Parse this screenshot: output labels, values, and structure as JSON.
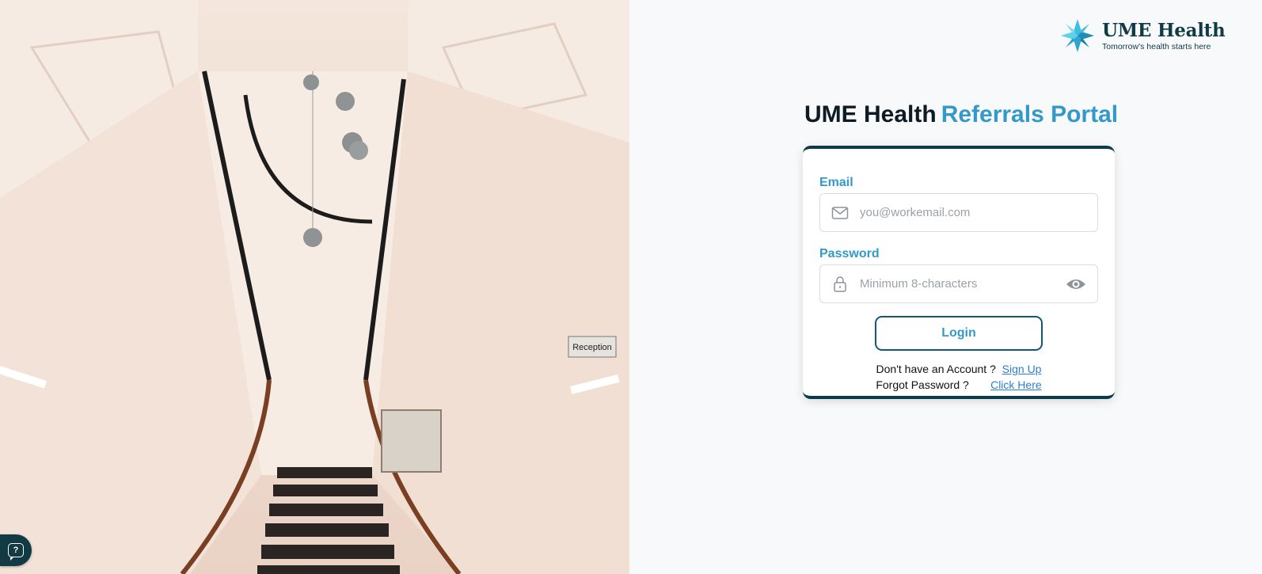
{
  "logo": {
    "name": "UME Health",
    "tagline": "Tomorrow's health starts here"
  },
  "heading": {
    "primary": "UME Health",
    "secondary": "Referrals Portal"
  },
  "photo": {
    "sign_text": "Reception"
  },
  "form": {
    "email_label": "Email",
    "email_placeholder": "you@workemail.com",
    "email_value": "",
    "password_label": "Password",
    "password_placeholder": "Minimum 8-characters",
    "password_value": "",
    "login_label": "Login",
    "signup_prompt": "Don't have an Account ?",
    "signup_link": "Sign Up",
    "forgot_prompt": "Forgot Password ?",
    "forgot_link": "Click Here"
  },
  "icons": {
    "email": "mail-icon",
    "password": "lock-icon",
    "toggle": "eye-icon",
    "help": "help-chat-icon",
    "logo": "cross-star-logo-icon"
  },
  "colors": {
    "brand_dark": "#0e3a47",
    "accent": "#3399c9",
    "link": "#2a7fd4"
  }
}
